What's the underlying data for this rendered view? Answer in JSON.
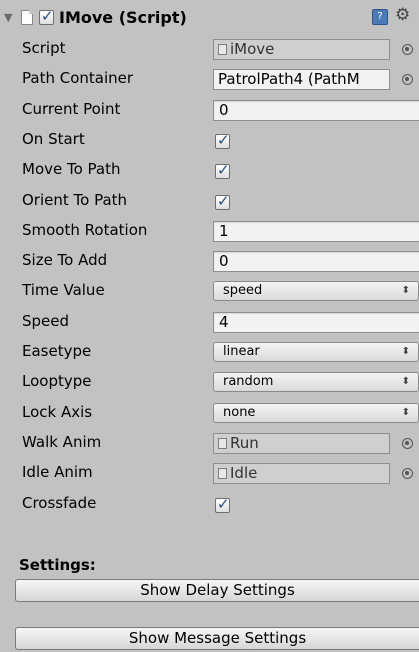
{
  "component": {
    "title": "IMove (Script)",
    "enabled": true,
    "header_icons": [
      "foldout-arrow-icon",
      "script-file-icon",
      "help-icon",
      "gear-icon"
    ]
  },
  "rows": [
    {
      "label": "Script",
      "type": "object",
      "value": "iMove",
      "dim": true
    },
    {
      "label": "Path Container",
      "type": "object",
      "value": "PatrolPath4 (PathM",
      "dim": false
    },
    {
      "label": "Current Point",
      "type": "text",
      "value": "0"
    },
    {
      "label": "On Start",
      "type": "checkbox",
      "checked": true
    },
    {
      "label": "Move To Path",
      "type": "checkbox",
      "checked": true
    },
    {
      "label": "Orient To Path",
      "type": "checkbox",
      "checked": true
    },
    {
      "label": "Smooth Rotation",
      "type": "text",
      "value": "1"
    },
    {
      "label": "Size To Add",
      "type": "text",
      "value": "0"
    },
    {
      "label": "Time Value",
      "type": "dropdown",
      "value": "speed"
    },
    {
      "label": "Speed",
      "type": "text",
      "value": "4"
    },
    {
      "label": "Easetype",
      "type": "dropdown",
      "value": "linear"
    },
    {
      "label": "Looptype",
      "type": "dropdown",
      "value": "random"
    },
    {
      "label": "Lock Axis",
      "type": "dropdown",
      "value": "none"
    },
    {
      "label": "Walk Anim",
      "type": "object",
      "value": "Run",
      "dim": true
    },
    {
      "label": "Idle Anim",
      "type": "object",
      "value": "Idle",
      "dim": true
    },
    {
      "label": "Crossfade",
      "type": "checkbox",
      "checked": true
    }
  ],
  "settings": {
    "label": "Settings:",
    "delay_button": "Show Delay Settings",
    "message_button": "Show Message Settings"
  },
  "icons": {
    "check": "✓",
    "dropdown_arrow": "⬍",
    "foldout": "▼",
    "gear": "⚙"
  },
  "colors": {
    "background": "#c2c2c2",
    "check": "#2a4c86",
    "help": "#4a7bb7"
  }
}
